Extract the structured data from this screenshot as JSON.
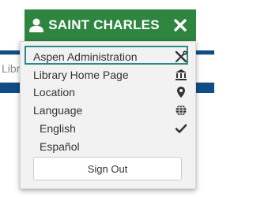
{
  "account": {
    "name": "SAINT CHARLES"
  },
  "search": {
    "placeholder": "Libra"
  },
  "menu": {
    "items": [
      {
        "label": "Aspen Administration",
        "icon": "tools-icon"
      },
      {
        "label": "Library Home Page",
        "icon": "library-building-icon"
      },
      {
        "label": "Location",
        "icon": "map-marker-icon"
      },
      {
        "label": "Language",
        "icon": "globe-icon"
      }
    ],
    "languages": [
      {
        "label": "English",
        "selected": true,
        "icon": "checkmark-icon"
      },
      {
        "label": "Español",
        "selected": false
      }
    ],
    "sign_out_label": "Sign Out"
  },
  "colors": {
    "account_green": "#2e8540",
    "nav_blue": "#0e4d87",
    "highlight_teal": "#2e8a86"
  }
}
